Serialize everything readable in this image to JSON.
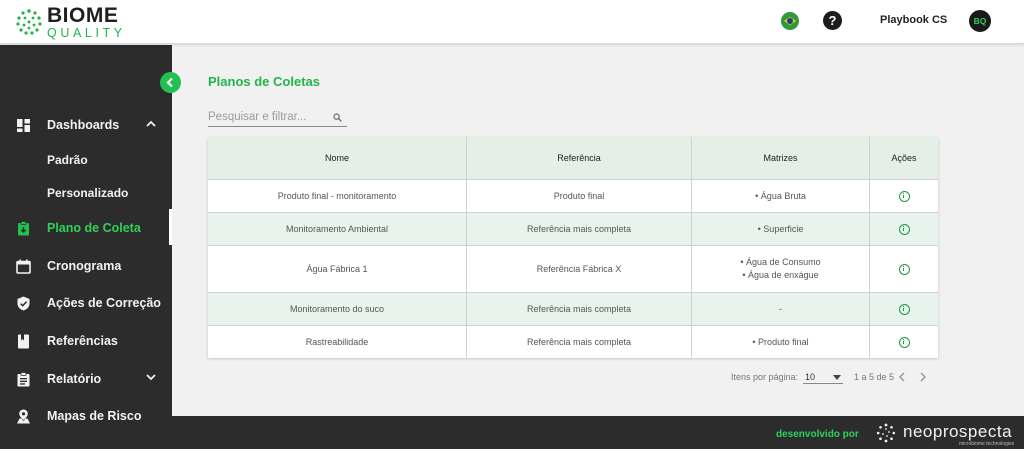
{
  "brand": {
    "name_top": "BIOME",
    "name_bottom": "QUALITY"
  },
  "header": {
    "user_name": "Playbook CS",
    "avatar_initials": "BQ",
    "help_symbol": "?",
    "language_flag": "brazil-flag-icon"
  },
  "sidebar": {
    "items": [
      {
        "label": "Dashboards",
        "icon": "dashboard-icon",
        "expanded": true
      },
      {
        "label": "Plano de Coleta",
        "icon": "clipboard-icon",
        "active": true
      },
      {
        "label": "Cronograma",
        "icon": "calendar-icon"
      },
      {
        "label": "Ações de Correção",
        "icon": "shield-check-icon"
      },
      {
        "label": "Referências",
        "icon": "book-icon"
      },
      {
        "label": "Relatório",
        "icon": "report-icon",
        "expanded": false
      },
      {
        "label": "Mapas de Risco",
        "icon": "map-pin-icon"
      }
    ],
    "dashboard_subitems": [
      "Padrão",
      "Personalizado"
    ]
  },
  "main": {
    "title": "Planos de Coletas",
    "search_placeholder": "Pesquisar e filtrar...",
    "table": {
      "headers": [
        "Nome",
        "Referência",
        "Matrizes",
        "Ações"
      ],
      "rows": [
        {
          "name": "Produto final - monitoramento",
          "reference": "Produto final",
          "matrices": [
            "• Água Bruta"
          ]
        },
        {
          "name": "Monitoramento Ambiental",
          "reference": "Referência mais completa",
          "matrices": [
            "• Superficie"
          ]
        },
        {
          "name": "Água Fábrica 1",
          "reference": "Referência Fábrica X",
          "matrices": [
            "• Água de Consumo",
            "• Água de enxágue"
          ]
        },
        {
          "name": "Monitoramento do suco",
          "reference": "Referência mais completa",
          "matrices": [
            "-"
          ]
        },
        {
          "name": "Rastreabilidade",
          "reference": "Referência mais completa",
          "matrices": [
            "• Produto final"
          ]
        }
      ]
    },
    "pagination": {
      "per_page_label": "Itens por página:",
      "per_page_value": "10",
      "range": "1 a 5 de 5"
    }
  },
  "footer": {
    "developed_by": "desenvolvido por",
    "company": "neoprospecta",
    "company_tagline": "microbiome technologies"
  },
  "colors": {
    "accent_green": "#22b44a",
    "sidebar_bg": "#2c2c2c",
    "row_alt": "#e9f3ed"
  }
}
